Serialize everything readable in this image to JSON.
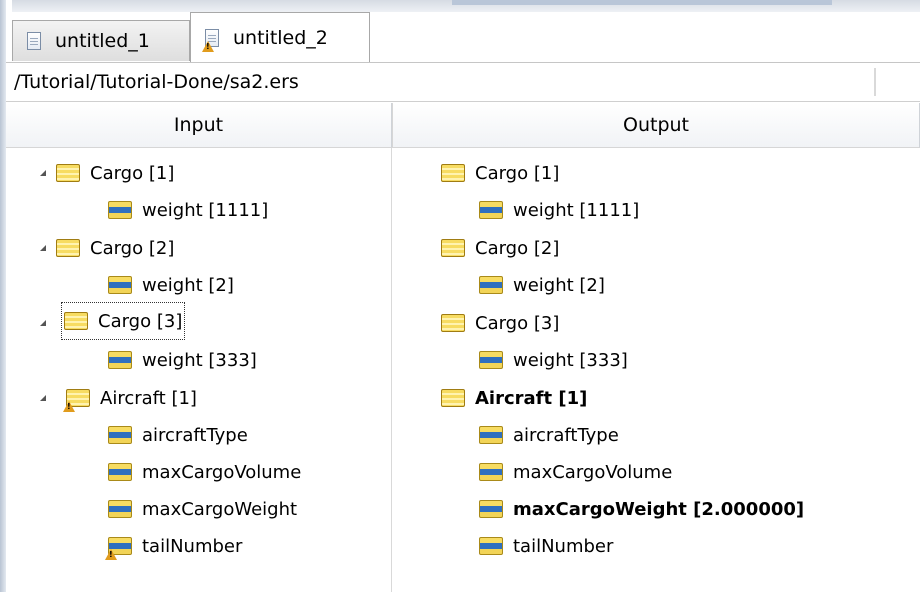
{
  "tabs": [
    {
      "label": "untitled_1",
      "icon": "document-icon",
      "active": false
    },
    {
      "label": "untitled_2",
      "icon": "document-warning-icon",
      "active": true
    }
  ],
  "path": "/Tutorial/Tutorial-Done/sa2.ers",
  "columns": {
    "input": "Input",
    "output": "Output"
  },
  "input_tree": [
    {
      "label": "Cargo [1]",
      "kind": "entity",
      "expanded": true
    },
    {
      "label": "weight [1111]",
      "kind": "attribute"
    },
    {
      "label": "Cargo [2]",
      "kind": "entity",
      "expanded": true
    },
    {
      "label": "weight [2]",
      "kind": "attribute"
    },
    {
      "label": "Cargo [3]",
      "kind": "entity",
      "expanded": true,
      "selected": true
    },
    {
      "label": "weight [333]",
      "kind": "attribute"
    },
    {
      "label": "Aircraft [1]",
      "kind": "entity",
      "expanded": true,
      "warning": true
    },
    {
      "label": "aircraftType",
      "kind": "attribute"
    },
    {
      "label": "maxCargoVolume",
      "kind": "attribute"
    },
    {
      "label": "maxCargoWeight",
      "kind": "attribute"
    },
    {
      "label": "tailNumber",
      "kind": "attribute",
      "warning": true
    }
  ],
  "output_tree": [
    {
      "label": "Cargo [1]",
      "kind": "entity"
    },
    {
      "label": "weight [1111]",
      "kind": "attribute"
    },
    {
      "label": "Cargo [2]",
      "kind": "entity"
    },
    {
      "label": "weight [2]",
      "kind": "attribute"
    },
    {
      "label": "Cargo [3]",
      "kind": "entity"
    },
    {
      "label": "weight [333]",
      "kind": "attribute"
    },
    {
      "label": "Aircraft [1]",
      "kind": "entity",
      "bold": true
    },
    {
      "label": "aircraftType",
      "kind": "attribute"
    },
    {
      "label": "maxCargoVolume",
      "kind": "attribute"
    },
    {
      "label": "maxCargoWeight [2.000000]",
      "kind": "attribute",
      "bold": true
    },
    {
      "label": "tailNumber",
      "kind": "attribute"
    }
  ],
  "colors": {
    "entity_icon": "#f7dc62",
    "attribute_bar": "#2f6fbf",
    "warning": "#e19c1d"
  }
}
